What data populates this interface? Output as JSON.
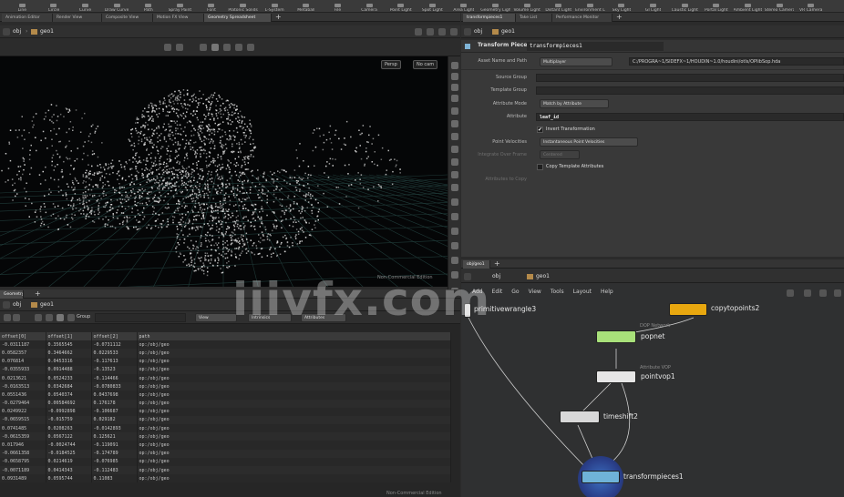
{
  "shelf": {
    "tools": [
      "Line",
      "Circle",
      "Curve",
      "Draw Curve",
      "Path",
      "Spray Paint",
      "Font",
      "Platonic Solids",
      "L-System",
      "Metaball",
      "File",
      "Camera",
      "Point Light",
      "Spot Light",
      "Area Light",
      "Geometry Light",
      "Volume Light",
      "Distant Light",
      "Environment Light",
      "Sky Light",
      "GI Light",
      "Caustic Light",
      "Portal Light",
      "Ambient Light",
      "Stereo Camera",
      "VR Camera"
    ]
  },
  "left_tabs": [
    "Animation Editor",
    "Render View",
    "Composite View",
    "Motion FX View",
    "Geometry Spreadsheet"
  ],
  "left_path": {
    "context": "obj",
    "node": "geo1"
  },
  "viewport": {
    "camera_menu": "Persp",
    "cam_menu": "No cam",
    "license": "Non-Commercial Edition"
  },
  "right_tabs": [
    "transformpieces1",
    "Take List",
    "Performance Monitor"
  ],
  "params": {
    "node_type": "Transform Pieces",
    "node_name": "transformpieces1",
    "rows": [
      {
        "label": "Asset Name and Path",
        "menu": "Multiplayer",
        "field": "C:/PROGRA~1/SIDEFX~1/HOUDIN~1.0/houdini/otls/OPlibSop.hda"
      },
      {
        "label": "Source Group",
        "field": ""
      },
      {
        "label": "Template Group",
        "field": ""
      },
      {
        "label": "Attribute Mode",
        "menu": "Match by Attribute"
      },
      {
        "label": "Attribute",
        "field": "leaf_id"
      },
      {
        "label": "Invert Transformation",
        "checked": true
      },
      {
        "label": "Point Velocities",
        "menu": "Instantaneous Point Velocities"
      },
      {
        "label": "Integrate Over Frame",
        "menu": "Centered"
      },
      {
        "label": "Copy Template Attributes",
        "checked": false
      },
      {
        "label": "Attributes to Copy",
        "field": ""
      }
    ]
  },
  "sheet": {
    "tab": "Geometry Spreadsheet",
    "path": {
      "context": "obj",
      "node": "geo1"
    },
    "group_label": "Group",
    "view_label": "View",
    "intrinsics_label": "Intrinsics",
    "attributes_label": "Attributes",
    "columns": [
      "offset[0]",
      "offset[1]",
      "offset[2]",
      "path"
    ],
    "rows": [
      [
        "-0.0311187",
        "0.3565545",
        "-0.0731112",
        "op:/obj/geo"
      ],
      [
        "0.0582357",
        "0.3464662",
        "0.0229533",
        "op:/obj/geo"
      ],
      [
        "0.076814",
        "0.0453316",
        "-0.117613",
        "op:/obj/geo"
      ],
      [
        "-0.0355933",
        "0.0914488",
        "-0.13523",
        "op:/obj/geo"
      ],
      [
        "0.0213621",
        "0.0524233",
        "-0.114466",
        "op:/obj/geo"
      ],
      [
        "-0.0163513",
        "0.0342684",
        "-0.0780833",
        "op:/obj/geo"
      ],
      [
        "0.0551436",
        "0.0540374",
        "0.0437698",
        "op:/obj/geo"
      ],
      [
        "-0.0279464",
        "0.00584692",
        "0.176178",
        "op:/obj/geo"
      ],
      [
        "0.0249922",
        "-0.0992898",
        "-0.106687",
        "op:/obj/geo"
      ],
      [
        "-0.0659515",
        "-0.015759",
        "0.029182",
        "op:/obj/geo"
      ],
      [
        "0.0741485",
        "0.0208263",
        "-0.0142893",
        "op:/obj/geo"
      ],
      [
        "-0.0615359",
        "0.0567122",
        "0.125621",
        "op:/obj/geo"
      ],
      [
        "0.017946",
        "-0.0024744",
        "-0.119091",
        "op:/obj/geo"
      ],
      [
        "-0.0661358",
        "-0.0184525",
        "-0.174789",
        "op:/obj/geo"
      ],
      [
        "-0.0658795",
        "0.0214619",
        "-0.076985",
        "op:/obj/geo"
      ],
      [
        "-0.0071189",
        "0.0414343",
        "-0.112483",
        "op:/obj/geo"
      ],
      [
        "0.0931489",
        "0.0595744",
        "0.11083",
        "op:/obj/geo"
      ]
    ],
    "license": "Non-Commercial Edition"
  },
  "network": {
    "path": {
      "context": "obj",
      "node": "geo1"
    },
    "menus": [
      "Add",
      "Edit",
      "Go",
      "View",
      "Tools",
      "Layout",
      "Help"
    ],
    "nodes": [
      {
        "name": "primitivewrangle3",
        "sub": "",
        "color": "#d9d9d9"
      },
      {
        "name": "copytopoints2",
        "sub": "",
        "color": "#e8a70f"
      },
      {
        "name": "popnet",
        "sub": "DOP Network",
        "color": "#a8e07a"
      },
      {
        "name": "pointvop1",
        "sub": "Attribute VOP",
        "color": "#e6e6e6"
      },
      {
        "name": "timeshift2",
        "sub": "",
        "color": "#d8d8d8"
      },
      {
        "name": "transformpieces1",
        "sub": "",
        "color": "#6fb3d8"
      }
    ]
  },
  "watermark": "iiivfx.com"
}
